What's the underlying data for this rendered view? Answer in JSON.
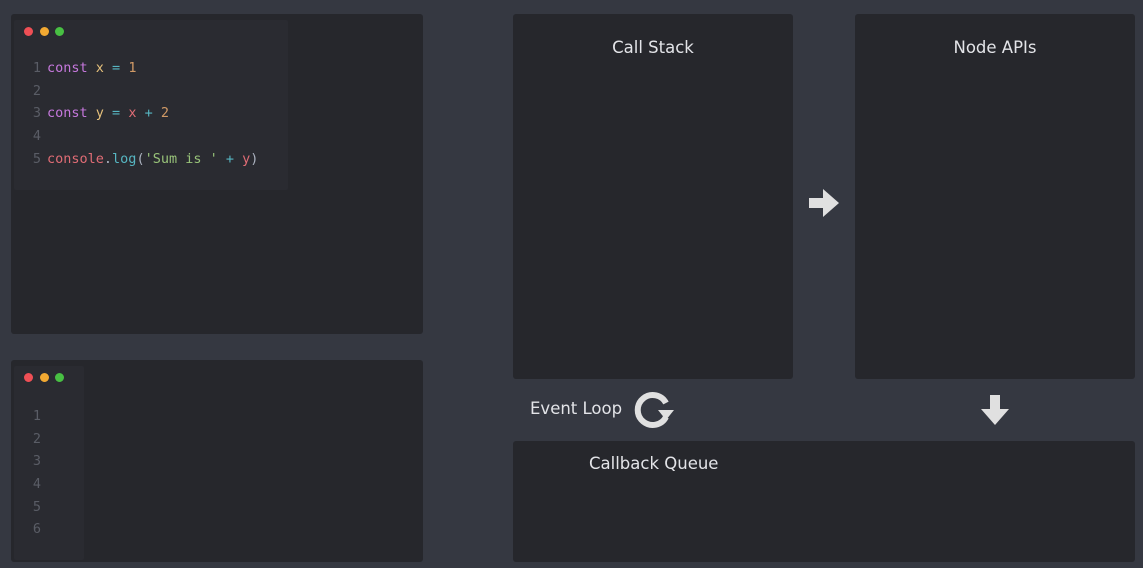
{
  "code_editor_top": {
    "lines": [
      {
        "n": "1",
        "tokens": [
          {
            "t": "const",
            "c": "kw"
          },
          {
            "t": " ",
            "c": "punc"
          },
          {
            "t": "x",
            "c": "var"
          },
          {
            "t": " = ",
            "c": "op"
          },
          {
            "t": "1",
            "c": "num"
          }
        ]
      },
      {
        "n": "2",
        "tokens": []
      },
      {
        "n": "3",
        "tokens": [
          {
            "t": "const",
            "c": "kw"
          },
          {
            "t": " ",
            "c": "punc"
          },
          {
            "t": "y",
            "c": "var"
          },
          {
            "t": " = ",
            "c": "op"
          },
          {
            "t": "x",
            "c": "obj"
          },
          {
            "t": " + ",
            "c": "op"
          },
          {
            "t": "2",
            "c": "num"
          }
        ]
      },
      {
        "n": "4",
        "tokens": []
      },
      {
        "n": "5",
        "tokens": [
          {
            "t": "console",
            "c": "obj"
          },
          {
            "t": ".",
            "c": "punc"
          },
          {
            "t": "log",
            "c": "fn"
          },
          {
            "t": "(",
            "c": "punc"
          },
          {
            "t": "'Sum is '",
            "c": "str"
          },
          {
            "t": " + ",
            "c": "op"
          },
          {
            "t": "y",
            "c": "obj"
          },
          {
            "t": ")",
            "c": "punc"
          }
        ]
      }
    ]
  },
  "code_editor_bottom": {
    "lines": [
      {
        "n": "1",
        "tokens": []
      },
      {
        "n": "2",
        "tokens": []
      },
      {
        "n": "3",
        "tokens": []
      },
      {
        "n": "4",
        "tokens": []
      },
      {
        "n": "5",
        "tokens": []
      },
      {
        "n": "6",
        "tokens": []
      }
    ]
  },
  "call_stack": {
    "title": "Call Stack"
  },
  "node_apis": {
    "title": "Node APIs"
  },
  "event_loop": {
    "label": "Event Loop",
    "icon": "refresh-icon"
  },
  "callback_queue": {
    "title": "Callback Queue"
  },
  "arrows": {
    "right": "arrow-right-icon",
    "down": "arrow-down-icon"
  },
  "colors": {
    "background": "#353841",
    "panel": "#26272c",
    "text": "#e3e4e8",
    "icon": "#e0e0e0",
    "keyword": "#c678dd",
    "variable": "#e5c07b",
    "number": "#d19a66",
    "string": "#98c379",
    "dot_red": "#ef4f55",
    "dot_yellow": "#f2a932",
    "dot_green": "#48c043"
  }
}
